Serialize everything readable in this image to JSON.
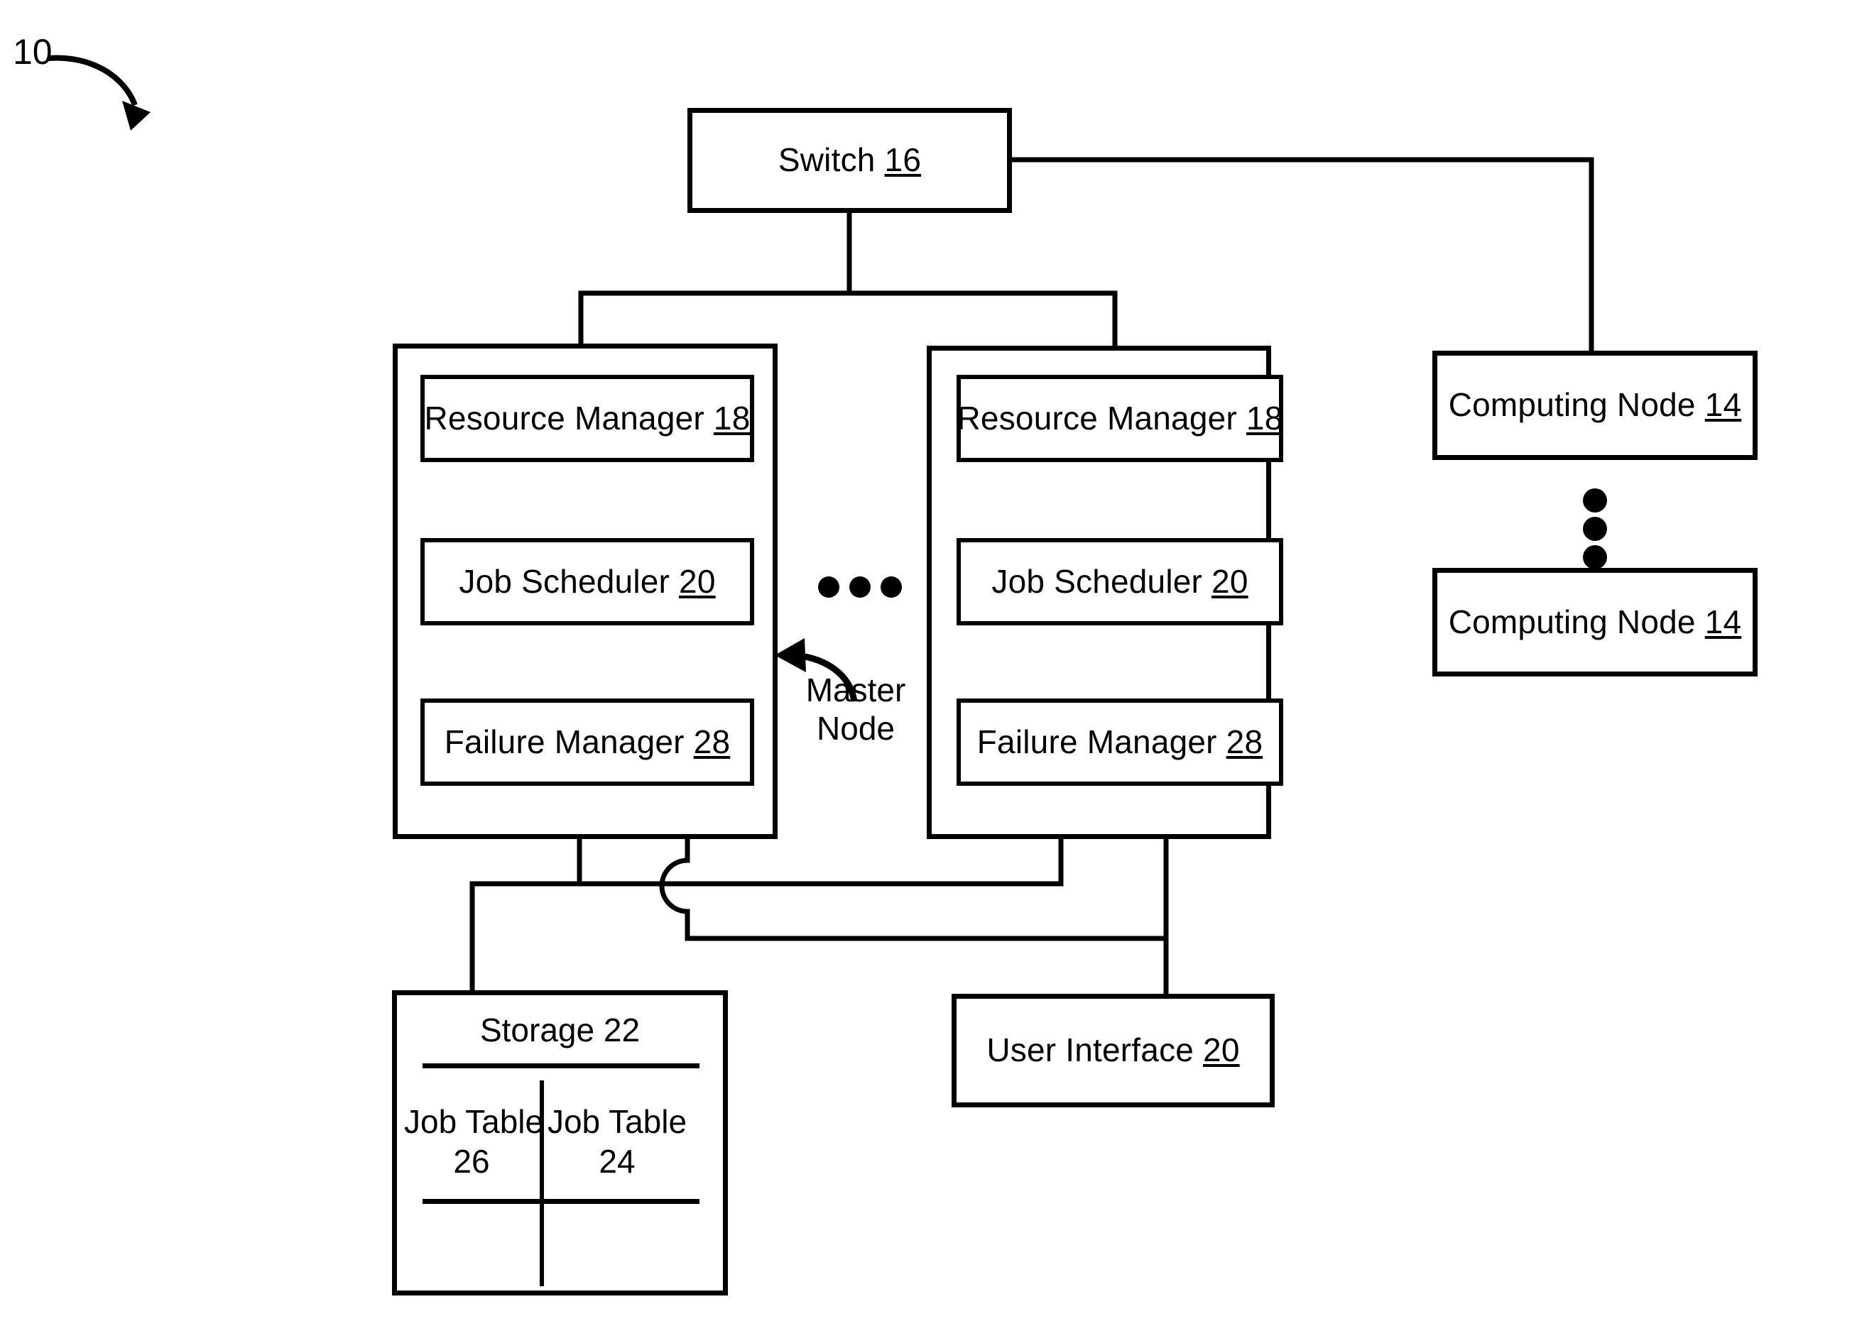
{
  "figure": {
    "reference_numeral": "10",
    "master_node_label_line1": "Master",
    "master_node_label_line2": "Node"
  },
  "switch": {
    "name": "Switch",
    "num": "16"
  },
  "nodes": [
    {
      "id": "left-master-node",
      "components": [
        {
          "name": "Resource Manager",
          "num": "18"
        },
        {
          "name": "Job Scheduler",
          "num": "20"
        },
        {
          "name": "Failure Manager",
          "num": "28"
        }
      ]
    },
    {
      "id": "right-master-node",
      "components": [
        {
          "name": "Resource Manager",
          "num": "18"
        },
        {
          "name": "Job Scheduler",
          "num": "20"
        },
        {
          "name": "Failure Manager",
          "num": "28"
        }
      ]
    }
  ],
  "computing_nodes": [
    {
      "name": "Computing Node",
      "num": "14"
    },
    {
      "name": "Computing Node",
      "num": "14"
    }
  ],
  "storage": {
    "name": "Storage",
    "num": "22",
    "tables": [
      {
        "name": "Job Table",
        "num": "26"
      },
      {
        "name": "Job Table",
        "num": "24"
      }
    ]
  },
  "user_interface": {
    "name": "User Interface",
    "num": "20"
  },
  "colors": {
    "line": "#000000",
    "background": "#ffffff"
  }
}
